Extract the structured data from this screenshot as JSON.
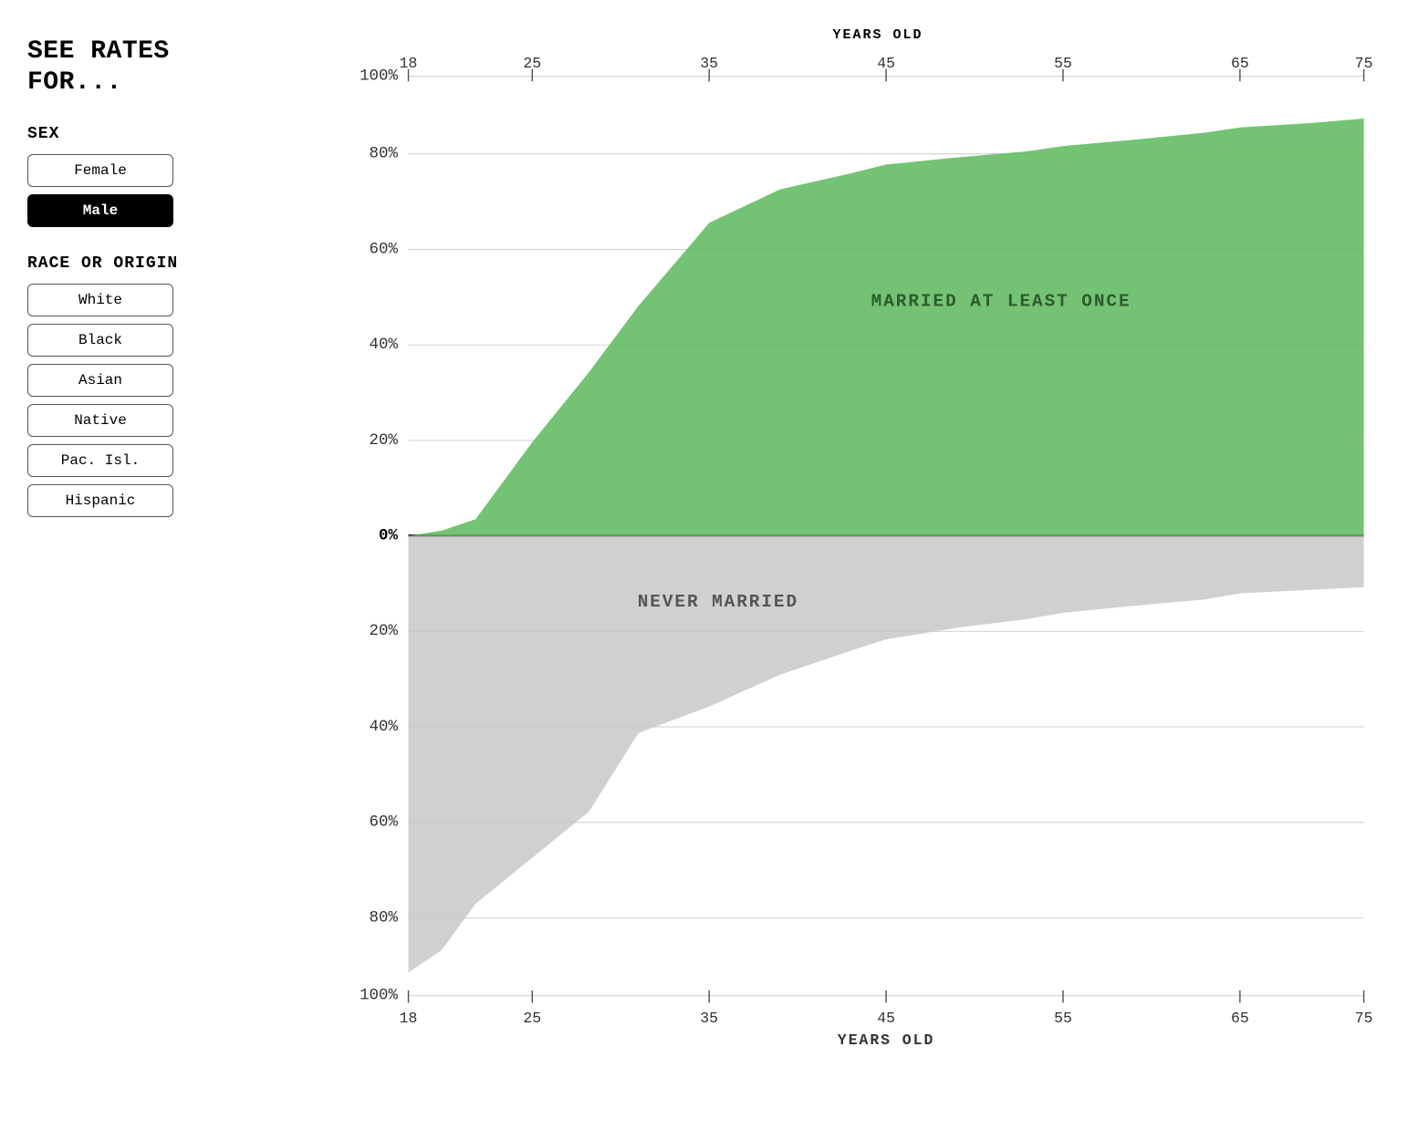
{
  "sidebar": {
    "title": "SEE RATES\nFOR...",
    "sex_label": "SEX",
    "sex_buttons": [
      {
        "label": "Female",
        "active": false
      },
      {
        "label": "Male",
        "active": true
      }
    ],
    "race_label": "RACE OR ORIGIN",
    "race_buttons": [
      {
        "label": "White",
        "active": false
      },
      {
        "label": "Black",
        "active": false
      },
      {
        "label": "Asian",
        "active": false
      },
      {
        "label": "Native",
        "active": false
      },
      {
        "label": "Pac. Isl.",
        "active": false
      },
      {
        "label": "Hispanic",
        "active": false
      }
    ]
  },
  "chart": {
    "top_axis_label": "YEARS OLD",
    "bottom_axis_label": "YEARS OLD",
    "x_ticks": [
      "18",
      "25",
      "35",
      "45",
      "55",
      "65",
      "75"
    ],
    "y_ticks_above": [
      "100%",
      "80%",
      "60%",
      "40%",
      "20%",
      "0%"
    ],
    "y_ticks_below": [
      "20%",
      "40%",
      "60%",
      "80%",
      "100%"
    ],
    "married_label": "MARRIED AT LEAST ONCE",
    "never_married_label": "NEVER MARRIED"
  }
}
